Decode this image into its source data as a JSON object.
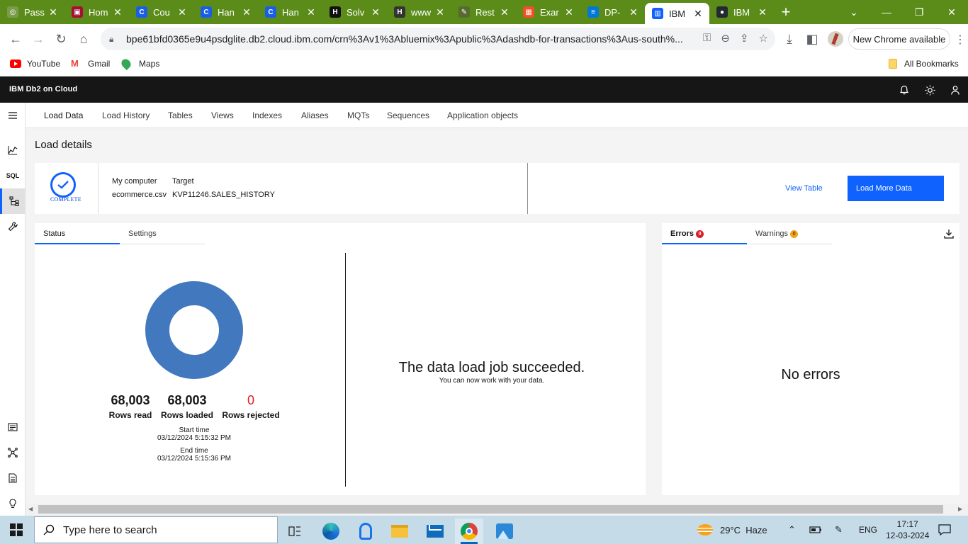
{
  "browser": {
    "tabs": [
      {
        "label": "Pass",
        "color": "#7a9c4a",
        "glyph": "◎"
      },
      {
        "label": "Hom",
        "color": "#a41034",
        "glyph": "▣"
      },
      {
        "label": "Cou",
        "color": "#1a5ee8",
        "glyph": "C"
      },
      {
        "label": "Han",
        "color": "#1a5ee8",
        "glyph": "C"
      },
      {
        "label": "Han",
        "color": "#1a5ee8",
        "glyph": "C"
      },
      {
        "label": "Solv",
        "color": "#111111",
        "glyph": "H"
      },
      {
        "label": "www",
        "color": "#333333",
        "glyph": "H"
      },
      {
        "label": "Rest",
        "color": "#556b2f",
        "glyph": "✎"
      },
      {
        "label": "Exar",
        "color": "#f25022",
        "glyph": "▦"
      },
      {
        "label": "DP-",
        "color": "#0078d4",
        "glyph": "≡"
      },
      {
        "label": "IBM",
        "color": "#0f62fe",
        "glyph": "▥"
      },
      {
        "label": "IBM",
        "color": "#24292f",
        "glyph": "●"
      }
    ],
    "url": "bpe61bfd0365e9u4psdglite.db2.cloud.ibm.com/crn%3Av1%3Abluemix%3Apublic%3Adashdb-for-transactions%3Aus-south%...",
    "new_chrome_label": "New Chrome available",
    "bookmarks": [
      {
        "label": "YouTube"
      },
      {
        "label": "Gmail"
      },
      {
        "label": "Maps"
      }
    ],
    "all_bookmarks_label": "All Bookmarks"
  },
  "app": {
    "brand": "IBM Db2 on Cloud",
    "nav": [
      "Load Data",
      "Load History",
      "Tables",
      "Views",
      "Indexes",
      "Aliases",
      "MQTs",
      "Sequences",
      "Application objects"
    ],
    "page_title": "Load details",
    "detail": {
      "status_label": "COMPLETE",
      "source_heading": "My computer",
      "source_value": "ecommerce.csv",
      "target_heading": "Target",
      "target_value": "KVP11246.SALES_HISTORY",
      "view_table": "View Table",
      "load_more": "Load More Data"
    },
    "status_panel": {
      "tabs": [
        "Status",
        "Settings"
      ],
      "rows_read": {
        "value": "68,003",
        "label": "Rows read"
      },
      "rows_loaded": {
        "value": "68,003",
        "label": "Rows loaded"
      },
      "rows_rejected": {
        "value": "0",
        "label": "Rows rejected"
      },
      "start_label": "Start time",
      "start_value": "03/12/2024 5:15:32 PM",
      "end_label": "End time",
      "end_value": "03/12/2024 5:15:36 PM",
      "success_title": "The data load job succeeded.",
      "success_sub": "You can now work with your data.",
      "donut_color": "#4178be"
    },
    "error_panel": {
      "errors_label": "Errors",
      "errors_count": "0",
      "warnings_label": "Warnings",
      "warnings_count": "0",
      "no_errors": "No errors"
    }
  },
  "taskbar": {
    "search_placeholder": "Type here to search",
    "weather": "29°C  Haze",
    "lang": "ENG",
    "time": "17:17",
    "date": "12-03-2024"
  },
  "colors": {
    "accent": "#0f62fe",
    "error": "#da1e28",
    "warning": "#f1a21b",
    "tabbar": "#5b8c1a"
  }
}
